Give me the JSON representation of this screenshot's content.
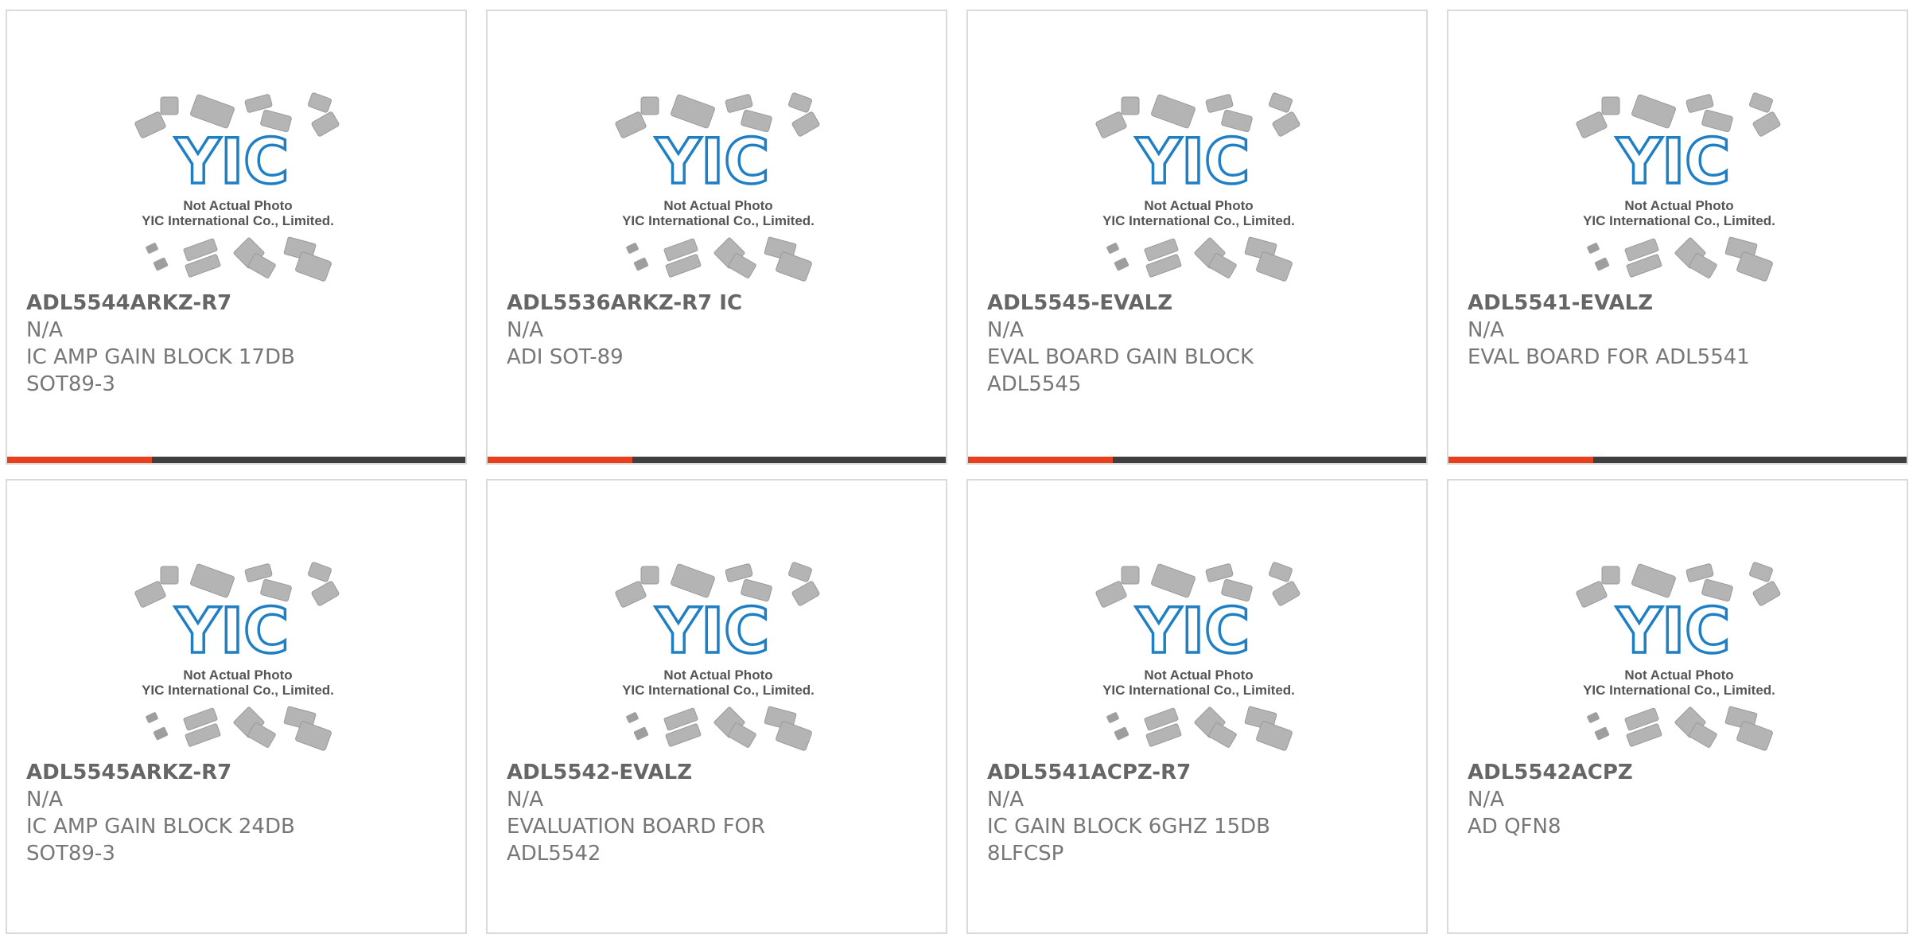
{
  "placeholder": {
    "line1": "Not Actual Photo",
    "line2": "YIC International Co., Limited.",
    "logo_text": "YIC",
    "logo_color": "#1f7fc4"
  },
  "accent_color": "#e8401c",
  "products": [
    {
      "name": "ADL5544ARKZ-R7",
      "manufacturer": "N/A",
      "description": "IC AMP GAIN BLOCK 17DB SOT89-3"
    },
    {
      "name": "ADL5536ARKZ-R7 IC",
      "manufacturer": "N/A",
      "description": "ADI SOT-89"
    },
    {
      "name": "ADL5545-EVALZ",
      "manufacturer": "N/A",
      "description": "EVAL BOARD GAIN BLOCK ADL5545"
    },
    {
      "name": "ADL5541-EVALZ",
      "manufacturer": "N/A",
      "description": "EVAL BOARD FOR ADL5541"
    },
    {
      "name": "ADL5545ARKZ-R7",
      "manufacturer": "N/A",
      "description": "IC AMP GAIN BLOCK 24DB SOT89-3"
    },
    {
      "name": "ADL5542-EVALZ",
      "manufacturer": "N/A",
      "description": "EVALUATION BOARD FOR ADL5542"
    },
    {
      "name": "ADL5541ACPZ-R7",
      "manufacturer": "N/A",
      "description": "IC GAIN BLOCK 6GHZ 15DB 8LFCSP"
    },
    {
      "name": "ADL5542ACPZ",
      "manufacturer": "N/A",
      "description": "AD QFN8"
    }
  ]
}
